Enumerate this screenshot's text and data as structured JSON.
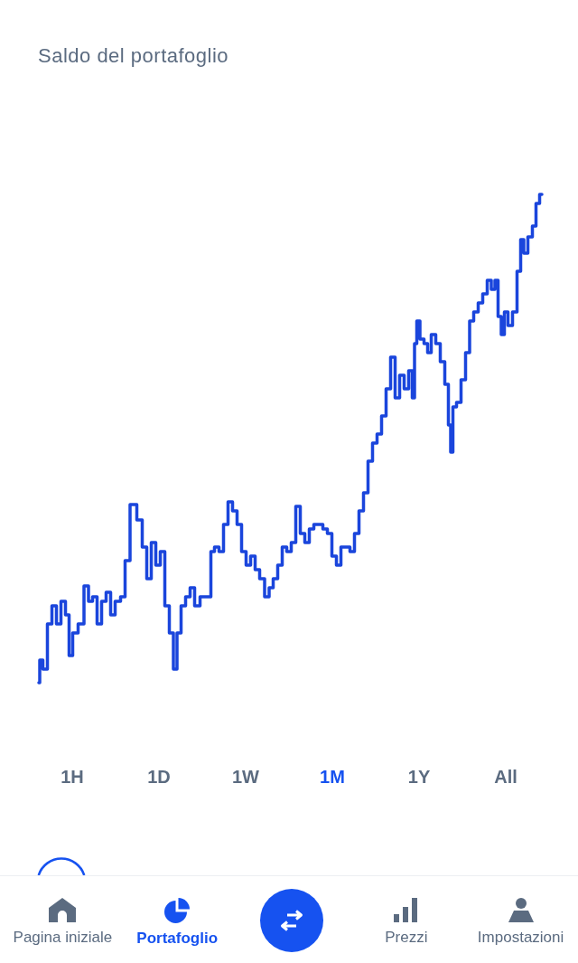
{
  "header": {
    "title": "Saldo del portafoglio"
  },
  "time_ranges": [
    {
      "label": "1H",
      "selected": false
    },
    {
      "label": "1D",
      "selected": false
    },
    {
      "label": "1W",
      "selected": false
    },
    {
      "label": "1M",
      "selected": true
    },
    {
      "label": "1Y",
      "selected": false
    },
    {
      "label": "All",
      "selected": false
    }
  ],
  "bottom_nav": [
    {
      "kind": "home",
      "label": "Pagina iniziale",
      "selected": false
    },
    {
      "kind": "portfolio",
      "label": "Portafoglio",
      "selected": true
    },
    {
      "kind": "prices",
      "label": "Prezzi",
      "selected": false
    },
    {
      "kind": "settings",
      "label": "Impostazioni",
      "selected": false
    }
  ]
}
